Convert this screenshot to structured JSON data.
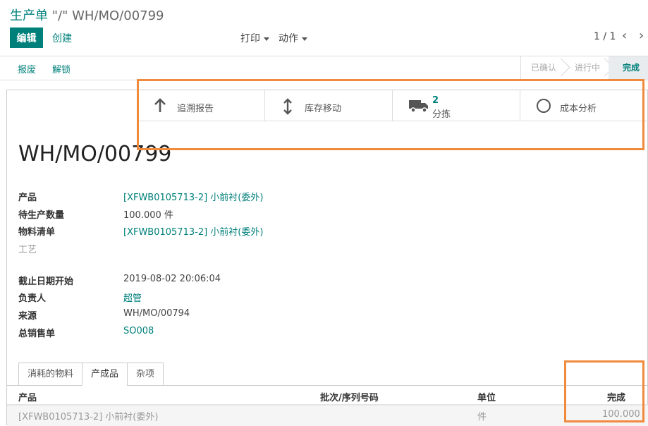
{
  "breadcrumb": {
    "root": "生产单",
    "separator": " \"/\" ",
    "current": "WH/MO/00799"
  },
  "toolbar": {
    "edit_label": "编辑",
    "create_label": "创建",
    "print_label": "打印",
    "action_label": "动作",
    "pager": "1 / 1",
    "prev": "‹",
    "next": "›"
  },
  "statusbar": {
    "scrap_label": "报废",
    "unlock_label": "解锁",
    "steps": [
      "已确认",
      "进行中",
      "完成"
    ],
    "active_step": "完成"
  },
  "smart_buttons": [
    {
      "icon": "arrow-up-icon",
      "label": "追溯报告"
    },
    {
      "icon": "arrows-vertical-icon",
      "label": "库存移动"
    },
    {
      "icon": "truck-icon",
      "count": "2",
      "label": "分拣"
    },
    {
      "icon": "circle-icon",
      "label": "成本分析"
    }
  ],
  "record": {
    "title": "WH/MO/00799",
    "fields": [
      {
        "label": "产品",
        "value": "[XFWB0105713-2] 小前衬(委外)",
        "link": true
      },
      {
        "label": "待生产数量",
        "value": "100.000 件",
        "link": false
      },
      {
        "label": "物料清单",
        "value": "[XFWB0105713-2] 小前衬(委外)",
        "link": true
      },
      {
        "label": "工艺",
        "value": "",
        "link": false
      },
      {
        "label": "截止日期开始",
        "value": "2019-08-02 20:06:04",
        "link": false
      },
      {
        "label": "负责人",
        "value": "超管",
        "link": true
      },
      {
        "label": "来源",
        "value": "WH/MO/00794",
        "link": false
      },
      {
        "label": "总销售单",
        "value": "SO008",
        "link": true
      }
    ]
  },
  "tabs": [
    "消耗的物料",
    "产成品",
    "杂项"
  ],
  "active_tab": "产成品",
  "table": {
    "headers": {
      "product": "产品",
      "lot": "批次/序列号码",
      "uom": "单位",
      "done": "完成"
    },
    "rows": [
      {
        "product": "[XFWB0105713-2] 小前衬(委外)",
        "lot": "",
        "uom": "件",
        "done": "100.000"
      }
    ]
  },
  "colors": {
    "accent": "#00807b",
    "annotation": "#f08a3c"
  }
}
